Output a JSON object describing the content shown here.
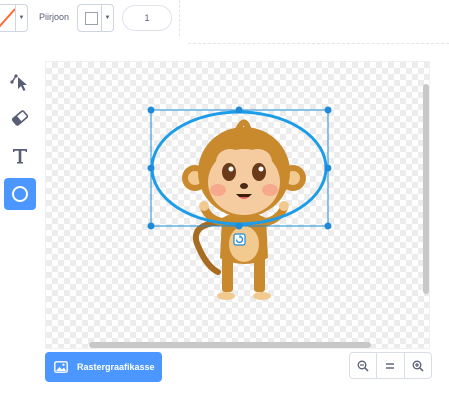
{
  "toolbar": {
    "fill_color": "#ff6b35",
    "outline_label": "Piirjoon",
    "outline_color": "#ffffff",
    "outline_width": "1"
  },
  "tools": [
    {
      "name": "reshape",
      "icon": "reshape-arrow-icon",
      "active": false
    },
    {
      "name": "eraser",
      "icon": "eraser-icon",
      "active": false
    },
    {
      "name": "text",
      "icon": "text-icon",
      "active": false
    },
    {
      "name": "circle",
      "icon": "circle-icon",
      "active": true
    }
  ],
  "canvas": {
    "sprite": "monkey",
    "selection_color": "#1d8bd8",
    "ellipse_stroke_color": "#1d9ce8"
  },
  "bottom": {
    "convert_button_label": "Rastergraafikasse",
    "zoom_buttons": [
      "zoom-out-icon",
      "zoom-reset-icon",
      "zoom-in-icon"
    ]
  },
  "colors": {
    "accent": "#4c97ff",
    "text": "#575e75"
  }
}
